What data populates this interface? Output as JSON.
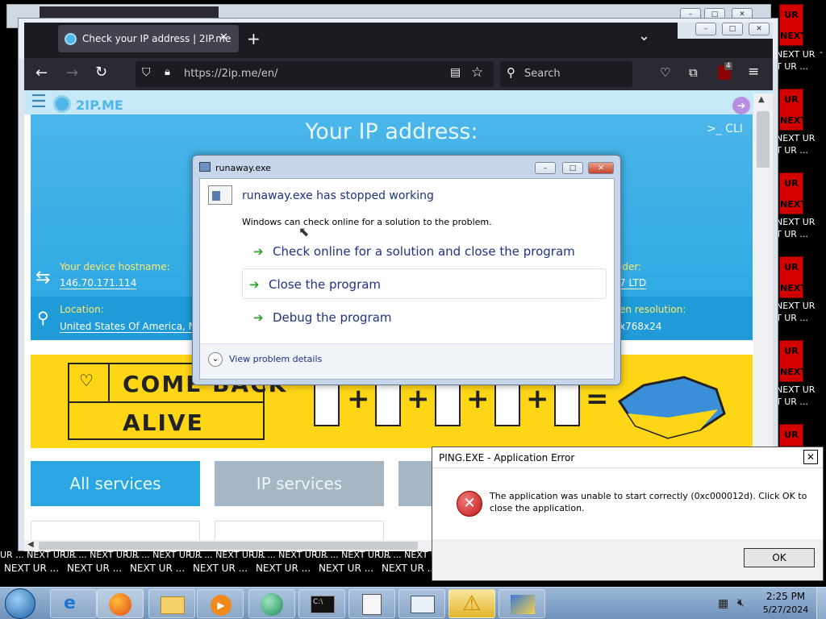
{
  "background": {
    "right_tiles": [
      {
        "top": "UR",
        "bottom": "NEXT"
      },
      {
        "top": "UR",
        "bottom": "NEXT"
      },
      {
        "top": "UR",
        "bottom": "NEXT"
      },
      {
        "top": "UR",
        "bottom": "NEXT"
      },
      {
        "top": "UR",
        "bottom": "NEXT"
      },
      {
        "top": "UR",
        "bottom": ""
      }
    ],
    "right_label_a": "NEXT UR",
    "right_label_b": "T UR ...",
    "right_label_dash": "-",
    "bottom_row_top": "UR ... NEXT UR ...",
    "bottom_row_label": "NEXT UR ..."
  },
  "browser": {
    "tab_title": "Check your IP address | 2IP.me",
    "tab_close": "✕",
    "new_tab": "+",
    "tab_list": "⌄",
    "url": "https://2ip.me/en/",
    "search_placeholder": "Search",
    "extension_badge": "4",
    "window_buttons": [
      "–",
      "□",
      "✕"
    ]
  },
  "page": {
    "logo_text": "2IP.ME",
    "heading": "Your IP address:",
    "cli_label": ">_ CLI",
    "hostname_label": "Your device hostname:",
    "hostname_value": "146.70.171.114",
    "provider_label": "ider:",
    "provider_value": "7 LTD",
    "location_label": "Location:",
    "location_value": "United States Of America, New",
    "resolution_label": "en resolution:",
    "resolution_value": "x768x24",
    "banner_line1": "COME BACK",
    "banner_line2": "ALIVE",
    "service_tabs": [
      "All services",
      "IP services"
    ]
  },
  "crash_dialog": {
    "title": "runaway.exe",
    "heading": "runaway.exe has stopped working",
    "message": "Windows can check online for a solution to the problem.",
    "options": [
      "Check online for a solution and close the program",
      "Close the program",
      "Debug the program"
    ],
    "details": "View problem details"
  },
  "error_dialog": {
    "title": "PING.EXE - Application Error",
    "message_line1": "The application was unable to start correctly (0xc000012d). Click OK to",
    "message_line2": "close the application.",
    "ok_label": "OK",
    "close_label": "✕"
  },
  "taskbar": {
    "time": "2:25 PM",
    "date": "5/27/2024",
    "items": [
      "start-orb",
      "internet-explorer",
      "firefox",
      "file-explorer",
      "media-player",
      "globe-app",
      "command-prompt",
      "notepad-app",
      "problem-reporting",
      "warning-app",
      "paint-app"
    ]
  }
}
